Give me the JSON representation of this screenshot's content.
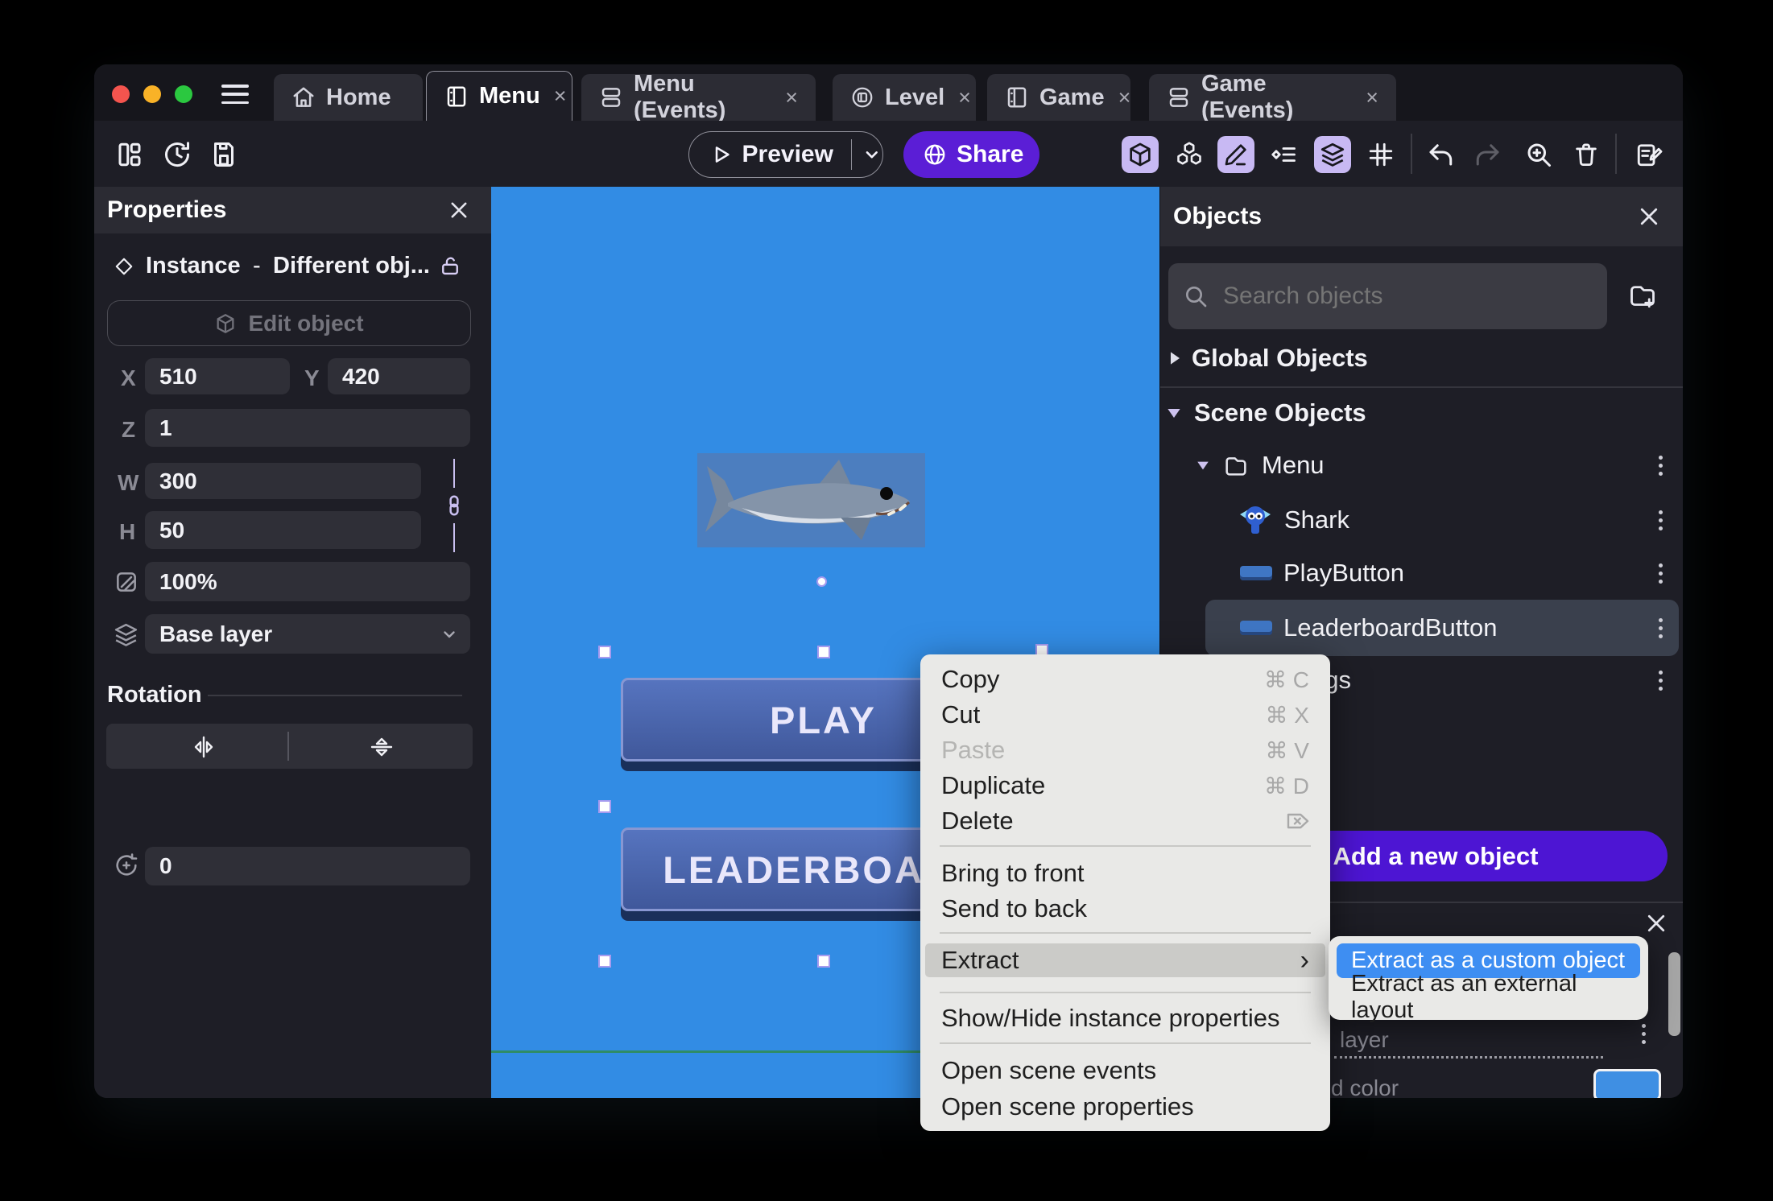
{
  "tabs": [
    {
      "label": "Home"
    },
    {
      "label": "Menu",
      "close": "×"
    },
    {
      "label": "Menu (Events)",
      "close": "×"
    },
    {
      "label": "Level",
      "close": "×"
    },
    {
      "label": "Game",
      "close": "×"
    },
    {
      "label": "Game (Events)",
      "close": "×"
    }
  ],
  "toolbar": {
    "preview_label": "Preview",
    "share_label": "Share"
  },
  "properties": {
    "title": "Properties",
    "instance_type": "Instance",
    "dash": "-",
    "instance_object": "Different obj...",
    "edit_object_label": "Edit object",
    "x_label": "X",
    "x_value": "510",
    "y_label": "Y",
    "y_value": "420",
    "z_label": "Z",
    "z_value": "1",
    "w_label": "W",
    "w_value": "300",
    "h_label": "H",
    "h_value": "50",
    "opacity_value": "100%",
    "layer_value": "Base layer",
    "rotation_title": "Rotation",
    "rotation_value": "0"
  },
  "canvas": {
    "play_label": "PLAY",
    "leaderboard_label": "LEADERBOARD"
  },
  "objects": {
    "title": "Objects",
    "search_placeholder": "Search objects",
    "global_section": "Global Objects",
    "scene_section": "Scene Objects",
    "folder_menu": "Menu",
    "item_shark": "Shark",
    "item_play": "PlayButton",
    "item_leaderboard": "LeaderboardButton",
    "folder_settings": "Settings",
    "add_button_label": "Add a new object",
    "add_button_plus": "+"
  },
  "context_menu": {
    "copy": "Copy",
    "copy_shortcut": "⌘ C",
    "cut": "Cut",
    "cut_shortcut": "⌘ X",
    "paste": "Paste",
    "paste_shortcut": "⌘ V",
    "duplicate": "Duplicate",
    "duplicate_shortcut": "⌘ D",
    "delete": "Delete",
    "bring_front": "Bring to front",
    "send_back": "Send to back",
    "extract": "Extract",
    "extract_arrow": "›",
    "show_hide": "Show/Hide instance properties",
    "open_events": "Open scene events",
    "open_props": "Open scene properties"
  },
  "submenu": {
    "custom_object": "Extract as a custom object",
    "external_layout": "Extract as an external layout"
  },
  "bottom_panel": {
    "layer_fragment": "layer",
    "color_fragment": "d color"
  },
  "icons": {
    "traffic_lights": "red/yellow/green window controls",
    "search": "magnifier",
    "folder_add": "folder with plus",
    "kebab": "vertical three dots",
    "delete_shortcut": "erase-right key glyph",
    "lock_open": "open padlock",
    "layers": "stacked layers",
    "grid": "hash grid",
    "undo": "arrow left",
    "redo": "arrow right"
  },
  "colors": {
    "accent_purple": "#5B1ED6",
    "add_button_purple": "#4D15D3",
    "canvas_blue": "#328CE4",
    "game_button_blue": "#4A63AB",
    "submenu_selection_blue": "#3E8EF2",
    "toolbar_highlight": "#C8B9F3"
  }
}
